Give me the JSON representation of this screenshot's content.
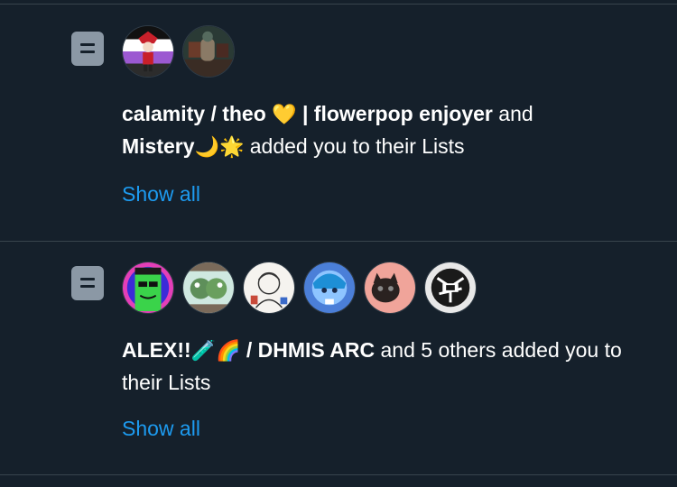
{
  "notifications": [
    {
      "user1_name": "calamity / theo",
      "user1_emoji": "💛",
      "user1_suffix": " | flowerpop enjoyer",
      "connector": "and",
      "user2_name": "Mistery",
      "user2_emoji": "🌙🌟",
      "action_text": "added you to their Lists",
      "show_all": "Show all",
      "avatars": [
        "avatar-jester",
        "avatar-figure"
      ]
    },
    {
      "user1_name": "ALEX!!",
      "user1_emoji": "🧪🌈",
      "user1_suffix": "/ DHMIS ARC",
      "others_text": "and 5 others added you to their Lists",
      "show_all": "Show all",
      "avatars": [
        "avatar-green-character",
        "avatar-frog-group",
        "avatar-sketch",
        "avatar-blue-character",
        "avatar-kitten",
        "avatar-bw-art"
      ]
    }
  ],
  "colors": {
    "background": "#15202b",
    "divider": "#38444d",
    "link": "#1d9bf0",
    "icon": "#8b98a5"
  },
  "icons": {
    "list": "list-icon"
  }
}
